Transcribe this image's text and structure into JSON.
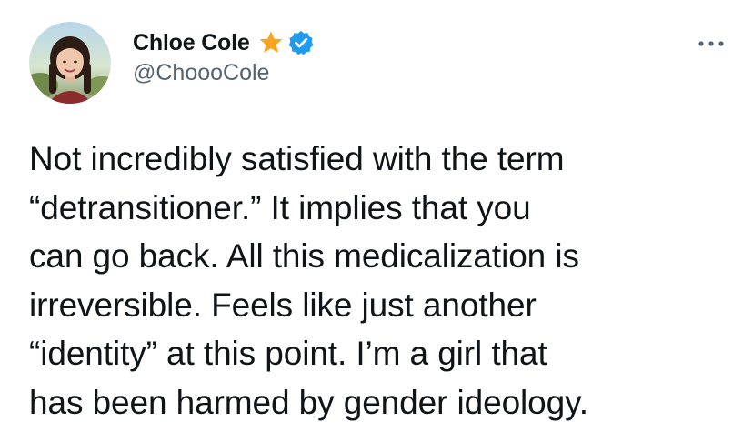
{
  "author": {
    "display_name": "Chloe Cole",
    "handle": "@ChoooCole",
    "badges": [
      "star-icon",
      "verified-icon"
    ],
    "avatar": "avatar-photo"
  },
  "tweet": {
    "text": "Not incredibly satisfied with the term\n“detransitioner.” It implies that you\ncan go back. All this medicalization is\nirreversible. Feels like just another\n“identity” at this point. I’m a girl that\nhas been harmed by gender ideology."
  },
  "icons": {
    "more": "more-horizontal-icon"
  },
  "colors": {
    "text_primary": "#0f1419",
    "text_secondary": "#536471",
    "verified_blue": "#1d9bf0",
    "star_gold": "#f4a623",
    "background": "#ffffff"
  }
}
